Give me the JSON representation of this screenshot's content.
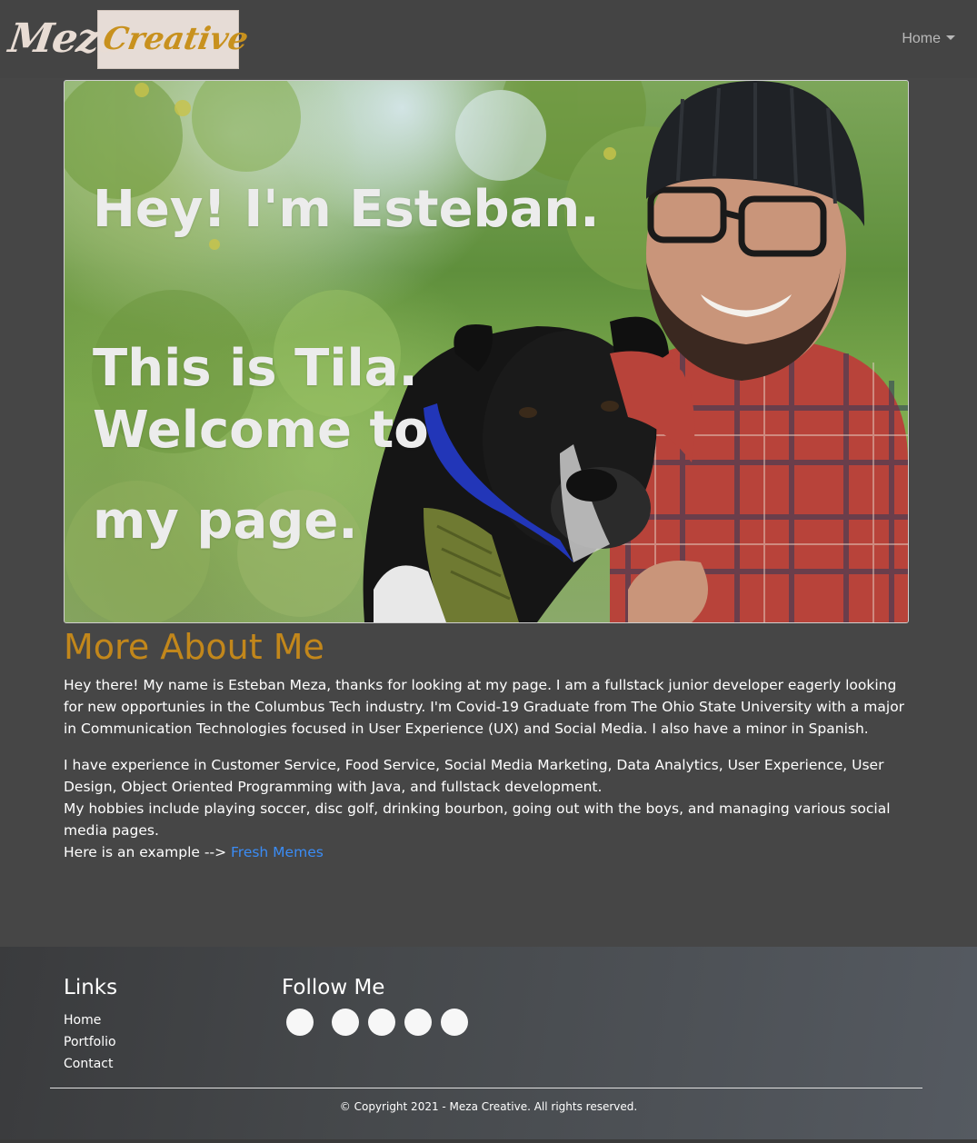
{
  "navbar": {
    "logo_meza": "Meza",
    "logo_creative": "Creative",
    "home_label": "Home"
  },
  "hero": {
    "line1": "Hey! I'm Esteban.",
    "line2": "This is Tila.",
    "line3": "Welcome to",
    "line4": "my page."
  },
  "about": {
    "heading": "More About Me",
    "p1": "Hey there! My name is Esteban Meza, thanks for looking at my page. I am a fullstack junior developer eagerly looking for new opportunies in the Columbus Tech industry. I'm Covid-19 Graduate from The Ohio State University with a major in Communication Technologies focused in User Experience (UX) and Social Media. I also have a minor in Spanish.",
    "p2_line1": "I have experience in Customer Service, Food Service, Social Media Marketing, Data Analytics, User Experience, User Design, Object Oriented Programming with Java, and fullstack development.",
    "p2_line2": "My hobbies include playing soccer, disc golf, drinking bourbon, going out with the boys, and managing various social media pages.",
    "p2_line3_prefix": "Here is an example -->",
    "p2_link": "Fresh Memes"
  },
  "footer": {
    "links_heading": "Links",
    "links": [
      "Home",
      "Portfolio",
      "Contact"
    ],
    "follow_heading": "Follow Me",
    "social_icons": [
      "social-icon-1",
      "social-icon-2",
      "social-icon-3",
      "social-icon-4",
      "social-icon-5"
    ],
    "copyright": "© Copyright 2021 - Meza Creative. All rights reserved."
  },
  "colors": {
    "accent": "#c2871b",
    "link": "#3b8cf5",
    "background": "#464646"
  }
}
